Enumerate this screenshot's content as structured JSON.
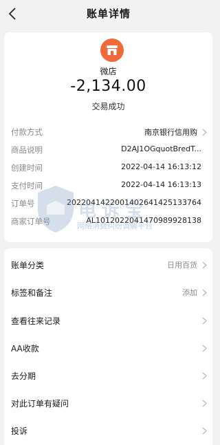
{
  "nav": {
    "title": "账单详情"
  },
  "merchant": {
    "name": "微店",
    "amount": "-2,134.00",
    "status": "交易成功",
    "logo_color": "#f06a3b"
  },
  "details": [
    {
      "label": "付款方式",
      "value": "南京银行信用购",
      "chevron": true
    },
    {
      "label": "商品说明",
      "value": "D2AJ1OGquotBredT...",
      "chevron": false
    },
    {
      "label": "创建时间",
      "value": "2022-04-14 16:13:12",
      "chevron": false
    },
    {
      "label": "支付时间",
      "value": "2022-04-14 16:13:13",
      "chevron": false
    },
    {
      "label": "订单号",
      "value": "2022041422001402641425133764",
      "chevron": false
    },
    {
      "label": "商家订单号",
      "value": "AL1012022041470989928138",
      "chevron": false
    }
  ],
  "actions": [
    {
      "label": "账单分类",
      "value": "日用百货"
    },
    {
      "label": "标签和备注",
      "value": "添加"
    },
    {
      "label": "查看往来记录",
      "value": ""
    },
    {
      "label": "AA收款",
      "value": ""
    },
    {
      "label": "去分期",
      "value": ""
    },
    {
      "label": "对此订单有疑问",
      "value": ""
    },
    {
      "label": "投诉",
      "value": ""
    }
  ],
  "watermark": {
    "title": "电诉宝",
    "subtitle": "网络消费纠纷调解平台"
  }
}
